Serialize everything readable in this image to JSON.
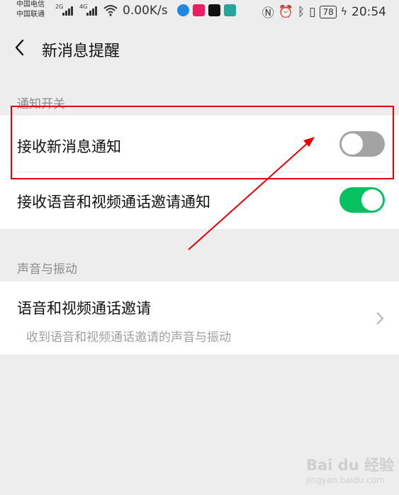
{
  "status_bar": {
    "carrier1": "中国电信",
    "carrier2": "中国联通",
    "sig1": "2G",
    "sig2": "4G",
    "speed": "0.00K/s",
    "battery": "78",
    "time": "20:54"
  },
  "header": {
    "title": "新消息提醒"
  },
  "sections": {
    "notify_label": "通知开关",
    "sound_label": "声音与振动"
  },
  "rows": {
    "receive_new_msg": {
      "label": "接收新消息通知",
      "enabled": false
    },
    "receive_call_invite": {
      "label": "接收语音和视频通话邀请通知",
      "enabled": true
    },
    "call_invite_sound": {
      "label": "语音和视频通话邀请",
      "sub": "收到语音和视频通话邀请的声音与振动"
    }
  },
  "colors": {
    "toggle_on": "#07c160",
    "toggle_off": "#a3a3a3",
    "annotation": "#e60000"
  },
  "watermark": {
    "brand": "Bai du 经验",
    "url": "jingyan.baidu.com"
  }
}
